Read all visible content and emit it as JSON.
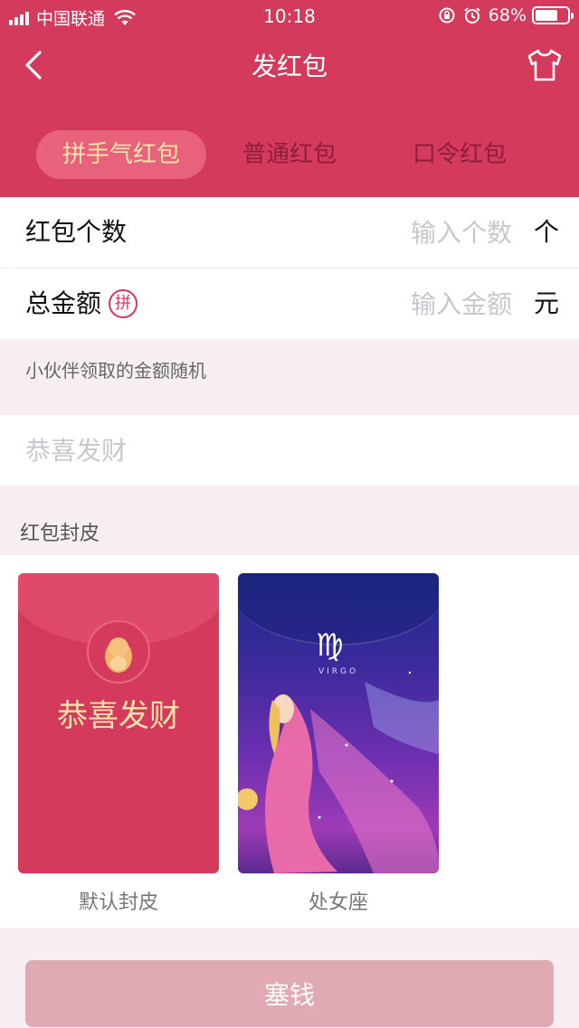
{
  "status_bar": {
    "carrier": "中国联通",
    "time": "10:18",
    "battery": "68%"
  },
  "nav": {
    "title": "发红包",
    "back_icon": "chevron-left-icon",
    "skin_icon": "tshirt-icon"
  },
  "tabs": [
    {
      "label": "拼手气红包",
      "active": true
    },
    {
      "label": "普通红包",
      "active": false
    },
    {
      "label": "口令红包",
      "active": false
    }
  ],
  "form": {
    "count": {
      "label": "红包个数",
      "placeholder": "输入个数",
      "unit": "个"
    },
    "amount": {
      "label": "总金额",
      "badge": "拼",
      "placeholder": "输入金额",
      "unit": "元"
    },
    "hint": "小伙伴领取的金额随机",
    "greeting_placeholder": "恭喜发财"
  },
  "skins": {
    "section_title": "红包封皮",
    "items": [
      {
        "name": "默认封皮",
        "cover_text": "恭喜发财"
      },
      {
        "name": "处女座",
        "cover_text": "VIRGO",
        "sign": "♍"
      }
    ]
  },
  "submit_label": "塞钱",
  "colors": {
    "primary": "#d43a5b",
    "tab_active_bg": "#e9627c",
    "gold": "#fbe3a9",
    "submit_disabled": "#e1a9b4"
  }
}
